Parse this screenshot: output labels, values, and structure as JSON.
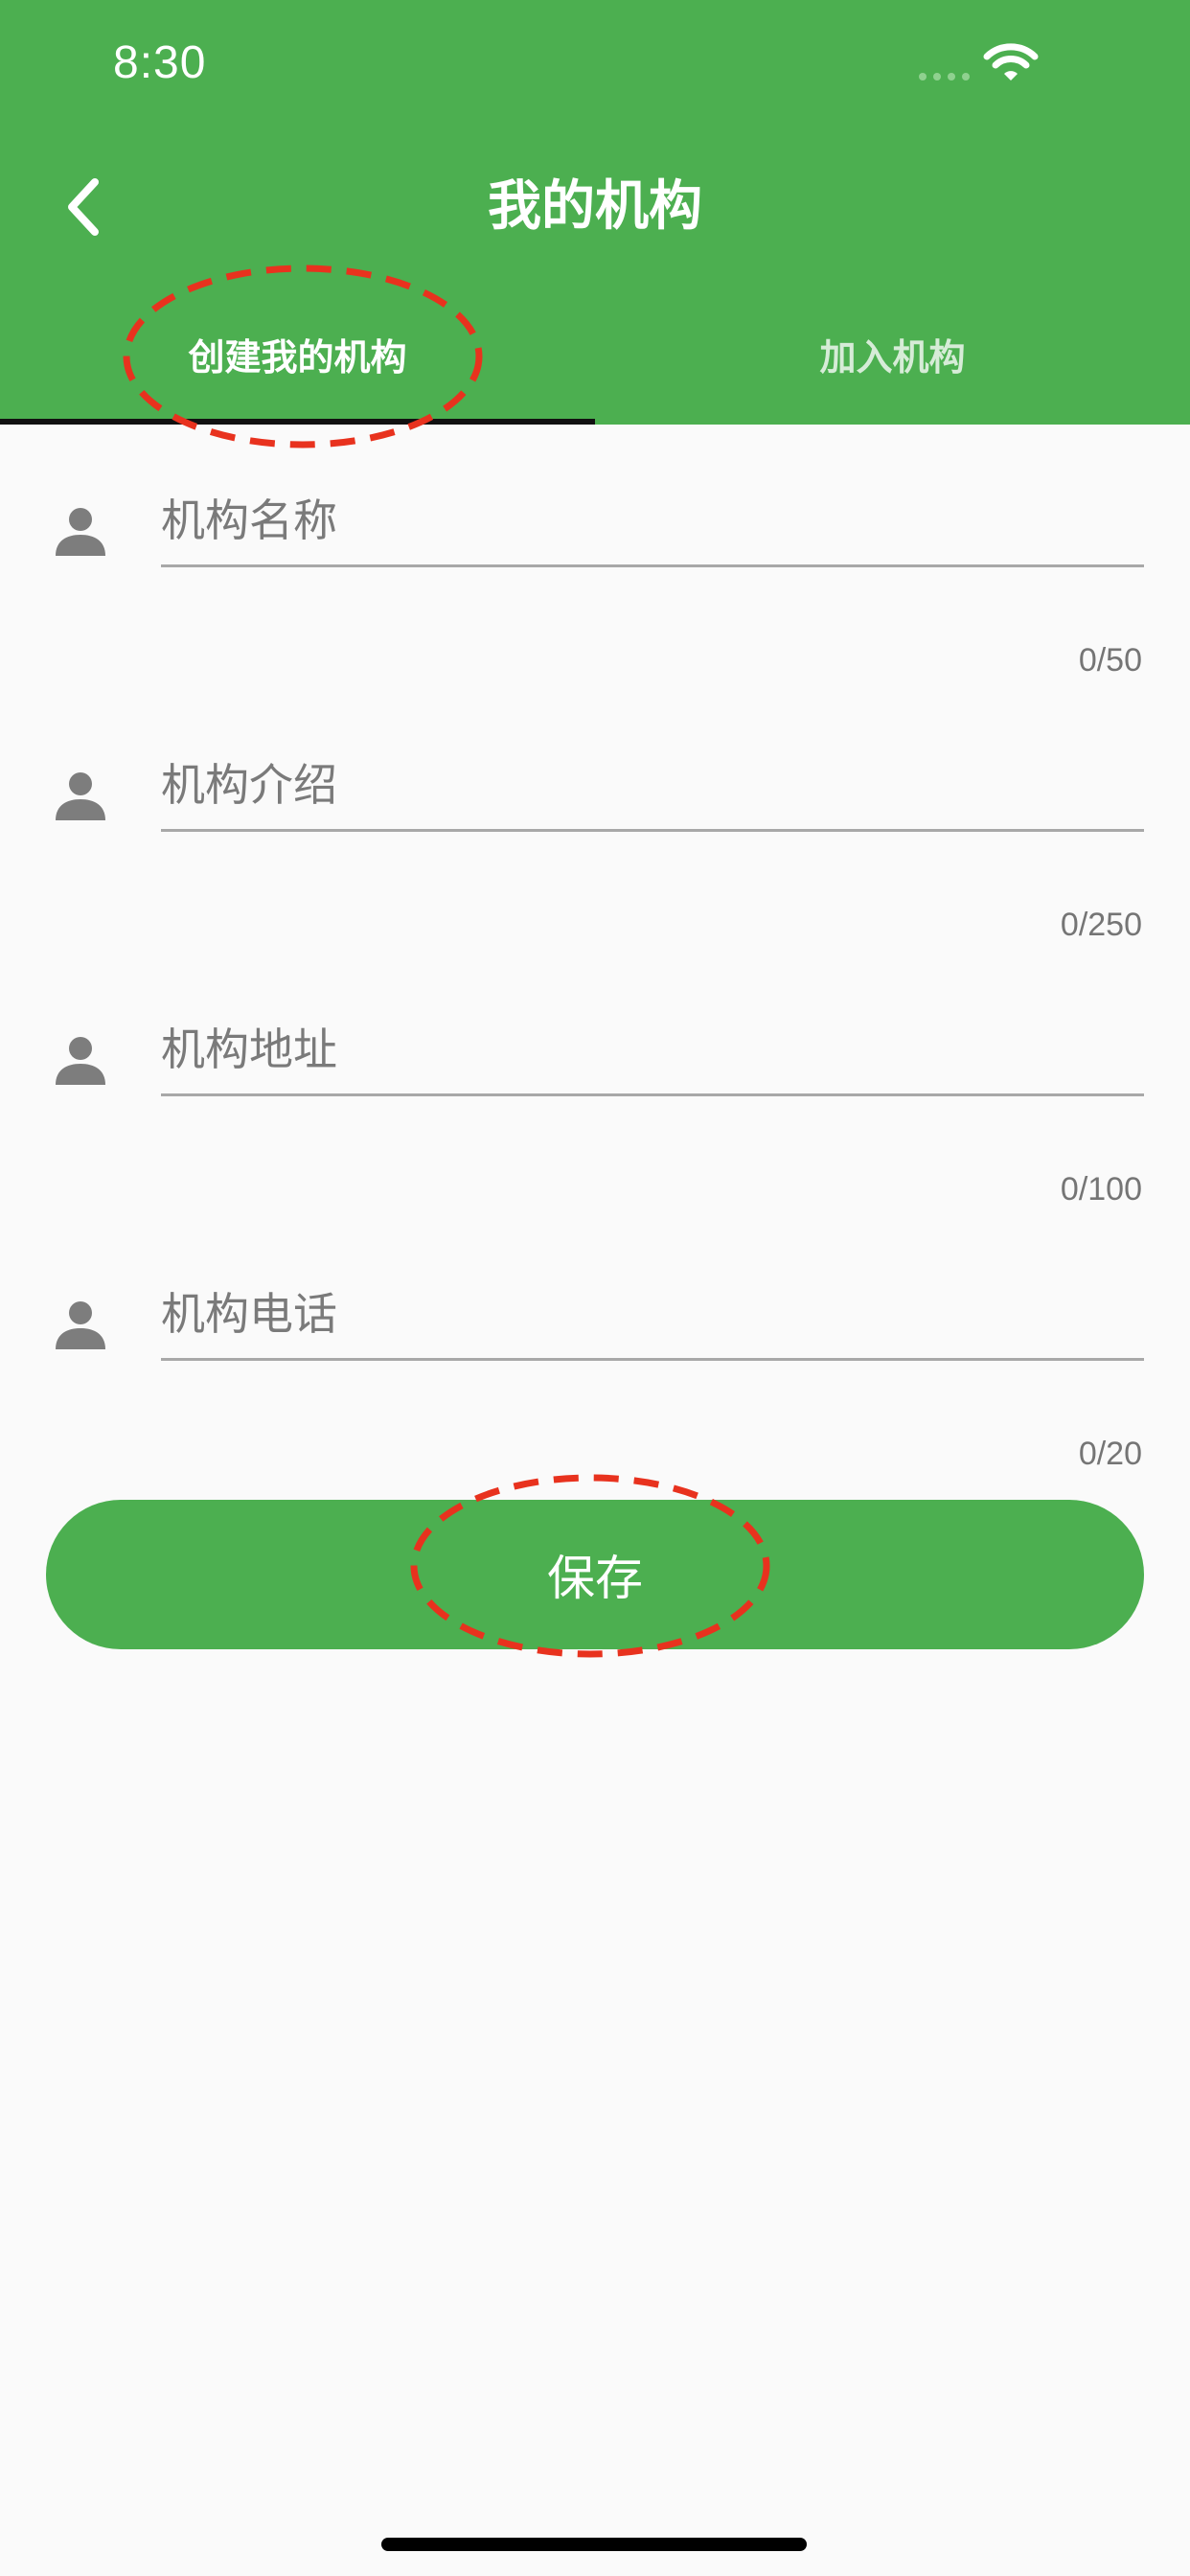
{
  "status_bar": {
    "time": "8:30"
  },
  "header": {
    "title": "我的机构",
    "back_icon": "chevron-left-icon",
    "background_color": "#4caf50"
  },
  "tabs": [
    {
      "label": "创建我的机构",
      "active": true
    },
    {
      "label": "加入机构",
      "active": false
    }
  ],
  "form": {
    "fields": [
      {
        "placeholder": "机构名称",
        "value": "",
        "counter": "0/50",
        "icon": "person-icon"
      },
      {
        "placeholder": "机构介绍",
        "value": "",
        "counter": "0/250",
        "icon": "person-icon"
      },
      {
        "placeholder": "机构地址",
        "value": "",
        "counter": "0/100",
        "icon": "person-icon"
      },
      {
        "placeholder": "机构电话",
        "value": "",
        "counter": "0/20",
        "icon": "person-icon"
      }
    ]
  },
  "save_button": {
    "label": "保存",
    "color": "#4caf50"
  },
  "annotations": {
    "color": "#e8321e",
    "style": "dashed-ellipse"
  }
}
